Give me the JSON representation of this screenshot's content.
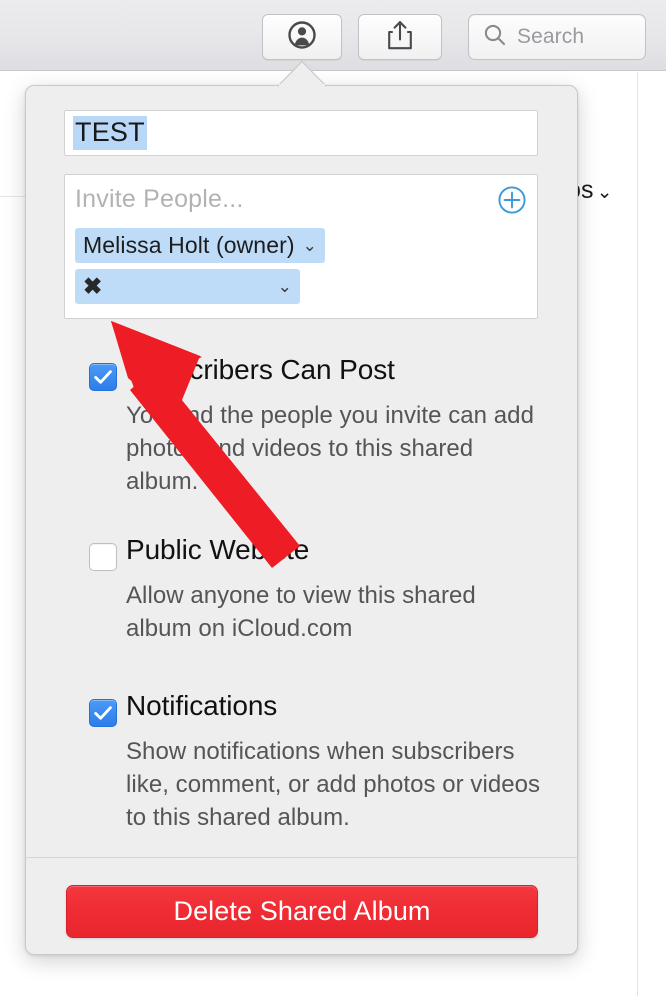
{
  "toolbar": {
    "person_button": {
      "icon": "person-circle-icon",
      "label": ""
    },
    "share_button": {
      "icon": "share-icon",
      "label": ""
    },
    "search": {
      "icon": "search-icon",
      "placeholder": "Search",
      "value": ""
    }
  },
  "background": {
    "photos_menu_fragment": "tos",
    "photos_menu_chevron": "⌄"
  },
  "popover": {
    "album_name_field": {
      "value": "TEST",
      "selected": true
    },
    "invite": {
      "placeholder": "Invite People...",
      "add_button_icon": "plus-circle-icon",
      "participants": [
        {
          "name": "Melissa Holt (owner)",
          "chevron": "⌄",
          "is_owner": true
        },
        {
          "name": "✖",
          "chevron": "⌄",
          "is_owner": false
        }
      ]
    },
    "options": [
      {
        "id": "subscribers-can-post",
        "title": "Subscribers Can Post",
        "description": "You and the people you invite can add photos and videos to this shared album.",
        "checked": true
      },
      {
        "id": "public-website",
        "title": "Public Website",
        "description": "Allow anyone to view this shared album on iCloud.com",
        "checked": false
      },
      {
        "id": "notifications",
        "title": "Notifications",
        "description": "Show notifications when subscribers like, comment, or add photos or videos to this shared album.",
        "checked": true
      }
    ],
    "delete_button": {
      "label": "Delete Shared Album"
    }
  },
  "annotation": {
    "arrow_color": "#ee1c25",
    "arrow_points_at": "second-participant-chip"
  },
  "colors": {
    "accent_blue": "#2c7de8",
    "selection_blue": "#b9d8f7",
    "chip_blue": "#bedcf7",
    "delete_red": "#ef2b33",
    "popover_bg": "#eeeeee",
    "toolbar_bg": "#e8e7ea",
    "annotation_red": "#ee1c25"
  }
}
